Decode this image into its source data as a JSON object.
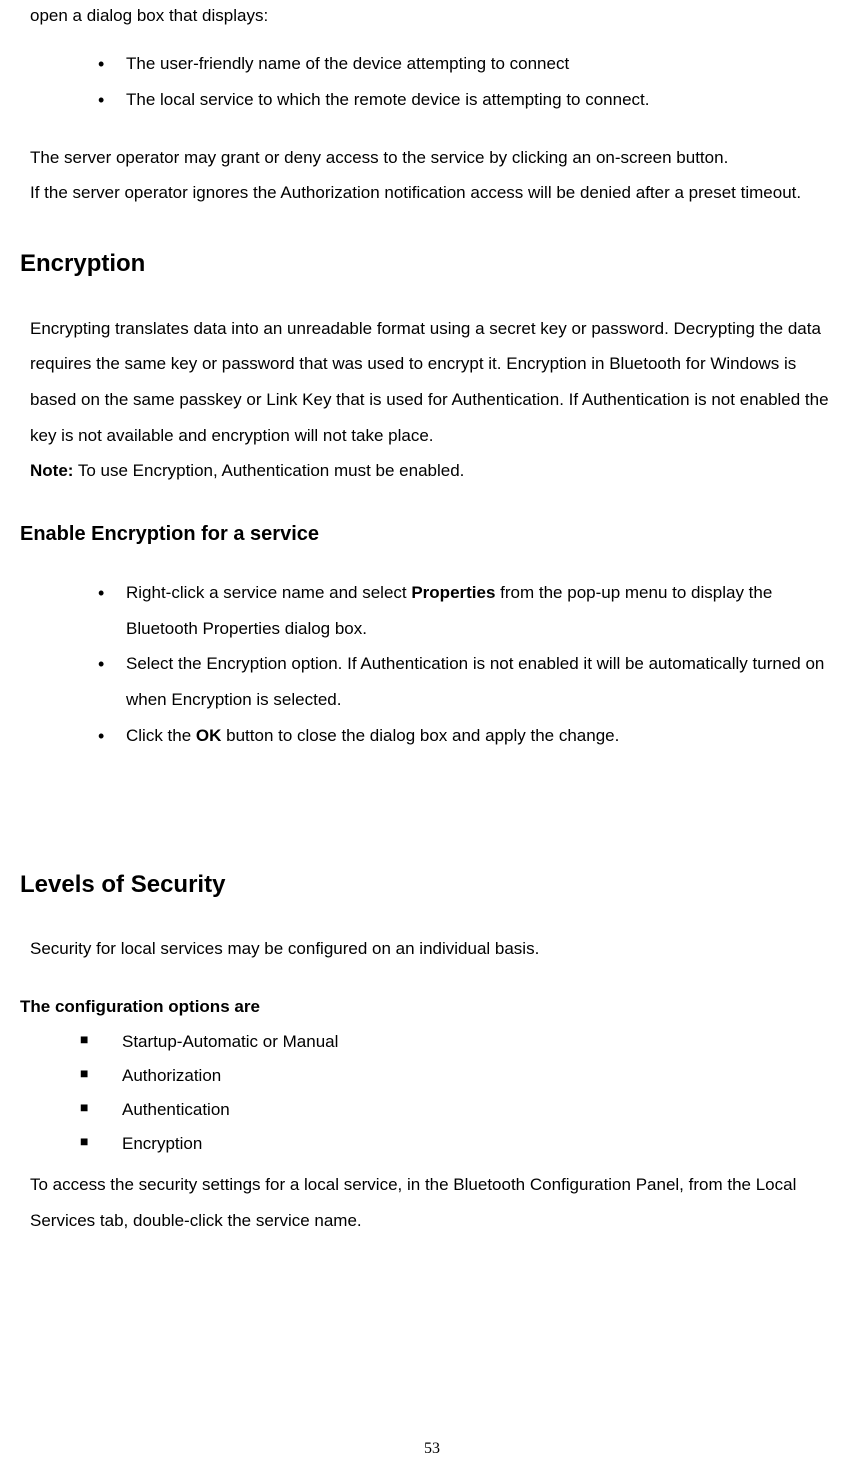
{
  "intro": "open a dialog box that displays:",
  "bullets1": [
    "The user-friendly name of the device attempting to connect",
    "The local service to which the remote device is attempting to connect."
  ],
  "para1": "The server operator may grant or deny access to the service by clicking an on-screen button.",
  "para2": "If the server operator ignores the Authorization notification access will be denied after a preset timeout.",
  "h1a": "Encryption",
  "enc_para": "Encrypting translates data into an unreadable format using a secret key or password. Decrypting the data requires the same key or password that was used to encrypt it. Encryption in Bluetooth for Windows is based on the same passkey or Link Key that is used for Authentication. If Authentication is not enabled the key is not available and encryption will not take place.",
  "note_label": "Note:",
  "note_text": " To use Encryption, Authentication must be enabled.",
  "h2a": "Enable Encryption for a service",
  "enable_b1_pre": "Right-click a service name and select ",
  "enable_b1_bold": "Properties",
  "enable_b1_post": " from the pop-up menu to display the Bluetooth Properties dialog box.",
  "enable_b2": "Select the Encryption option. If Authentication is not enabled it will be automatically turned on when Encryption is selected.",
  "enable_b3_pre": "Click the ",
  "enable_b3_bold": "OK",
  "enable_b3_post": " button to close the dialog box and apply the change.",
  "h1b": "Levels of Security",
  "levels_intro": "Security for local services may be configured on an individual basis.",
  "h3a": "The configuration options are",
  "options": [
    "Startup-Automatic or Manual",
    "Authorization",
    "Authentication",
    "Encryption"
  ],
  "closing": "To access the security settings for a local service, in the Bluetooth Configuration Panel, from the Local Services tab, double-click the service name.",
  "page": "53"
}
